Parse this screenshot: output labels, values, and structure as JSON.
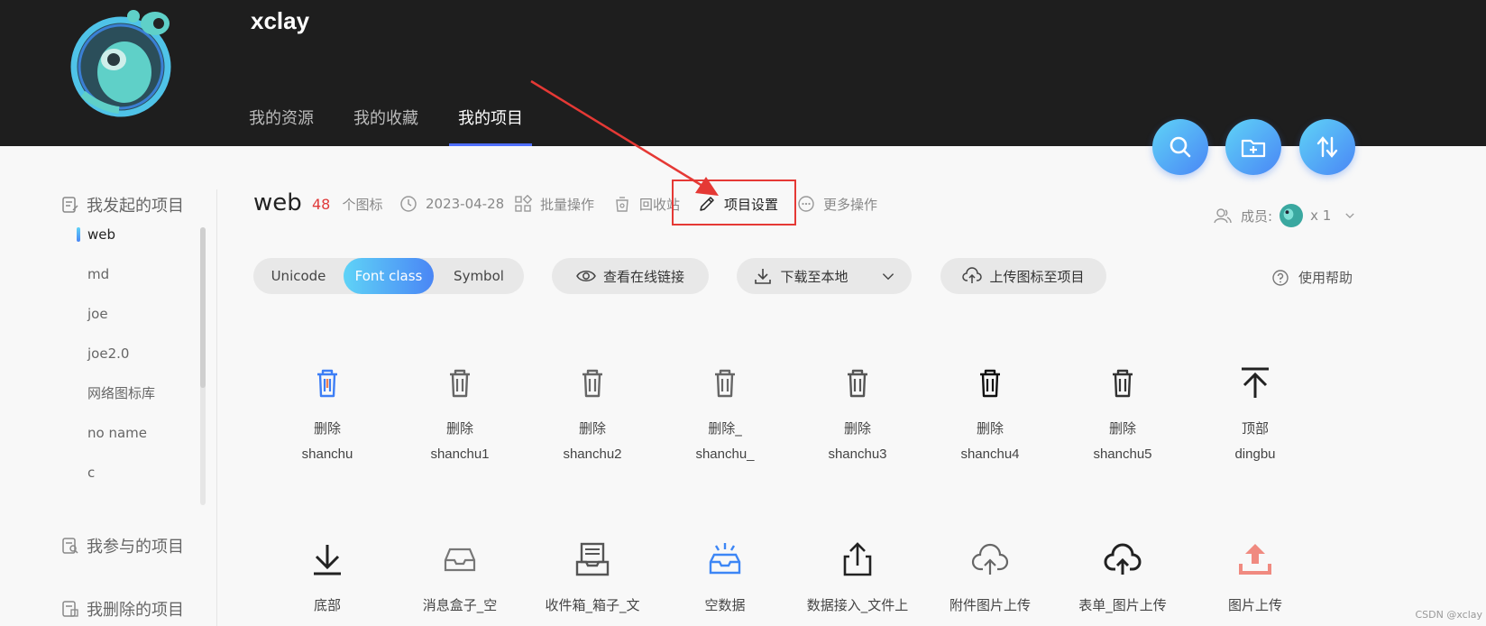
{
  "header": {
    "username": "xclay",
    "tabs": [
      {
        "label": "我的资源"
      },
      {
        "label": "我的收藏"
      },
      {
        "label": "我的项目"
      }
    ]
  },
  "sidebar": {
    "sections": {
      "initiated": "我发起的项目",
      "participated": "我参与的项目",
      "deleted": "我删除的项目"
    },
    "projects": [
      "web",
      "md",
      "joe",
      "joe2.0",
      "网络图标库",
      "no name",
      "c"
    ]
  },
  "project": {
    "name": "web",
    "count": "48",
    "count_unit": "个图标",
    "date": "2023-04-28",
    "batch_label": "批量操作",
    "recycle_label": "回收站",
    "settings_label": "项目设置",
    "more_label": "更多操作",
    "members_label": "成员:",
    "members_count": "x 1"
  },
  "actions": {
    "modes": [
      "Unicode",
      "Font class",
      "Symbol"
    ],
    "active_mode": "Font class",
    "view_link": "查看在线链接",
    "download": "下载至本地",
    "upload": "上传图标至项目",
    "help": "使用帮助"
  },
  "icons": [
    {
      "name": "删除",
      "cls": "shanchu",
      "icon": "trash-icon",
      "color": "#3d7ef5"
    },
    {
      "name": "删除",
      "cls": "shanchu1",
      "icon": "trash-icon",
      "color": "#666666"
    },
    {
      "name": "删除",
      "cls": "shanchu2",
      "icon": "trash-icon",
      "color": "#666666"
    },
    {
      "name": "删除_",
      "cls": "shanchu_",
      "icon": "trash-icon",
      "color": "#666666"
    },
    {
      "name": "删除",
      "cls": "shanchu3",
      "icon": "trash-icon",
      "color": "#555555"
    },
    {
      "name": "删除",
      "cls": "shanchu4",
      "icon": "trash-icon",
      "color": "#111111"
    },
    {
      "name": "删除",
      "cls": "shanchu5",
      "icon": "trash-icon",
      "color": "#333333"
    },
    {
      "name": "顶部",
      "cls": "dingbu",
      "icon": "arrow-up-to-top-icon",
      "color": "#222222"
    },
    {
      "name": "底部",
      "cls": "",
      "icon": "download-bottom-icon",
      "color": "#222222"
    },
    {
      "name": "消息盒子_空",
      "cls": "",
      "icon": "inbox-empty-icon",
      "color": "#777777"
    },
    {
      "name": "收件箱_箱子_文",
      "cls": "",
      "icon": "inbox-doc-icon",
      "color": "#555555"
    },
    {
      "name": "空数据",
      "cls": "",
      "icon": "empty-data-icon",
      "color": "#3d86f5"
    },
    {
      "name": "数据接入_文件上",
      "cls": "",
      "icon": "upload-share-icon",
      "color": "#222222"
    },
    {
      "name": "附件图片上传",
      "cls": "",
      "icon": "cloud-upload-icon",
      "color": "#666666"
    },
    {
      "name": "表单_图片上传",
      "cls": "",
      "icon": "cloud-upload-solid-icon",
      "color": "#222222"
    },
    {
      "name": "图片上传",
      "cls": "",
      "icon": "upload-tray-icon",
      "color": "#f08a80"
    }
  ],
  "watermark": "CSDN @xclay",
  "colors": {
    "header_bg": "#1e1e1e",
    "accent_gradient_start": "#5fd3f7",
    "accent_gradient_end": "#4a86f5",
    "count_red": "#e03a3a",
    "annotation_red": "#e53935"
  }
}
